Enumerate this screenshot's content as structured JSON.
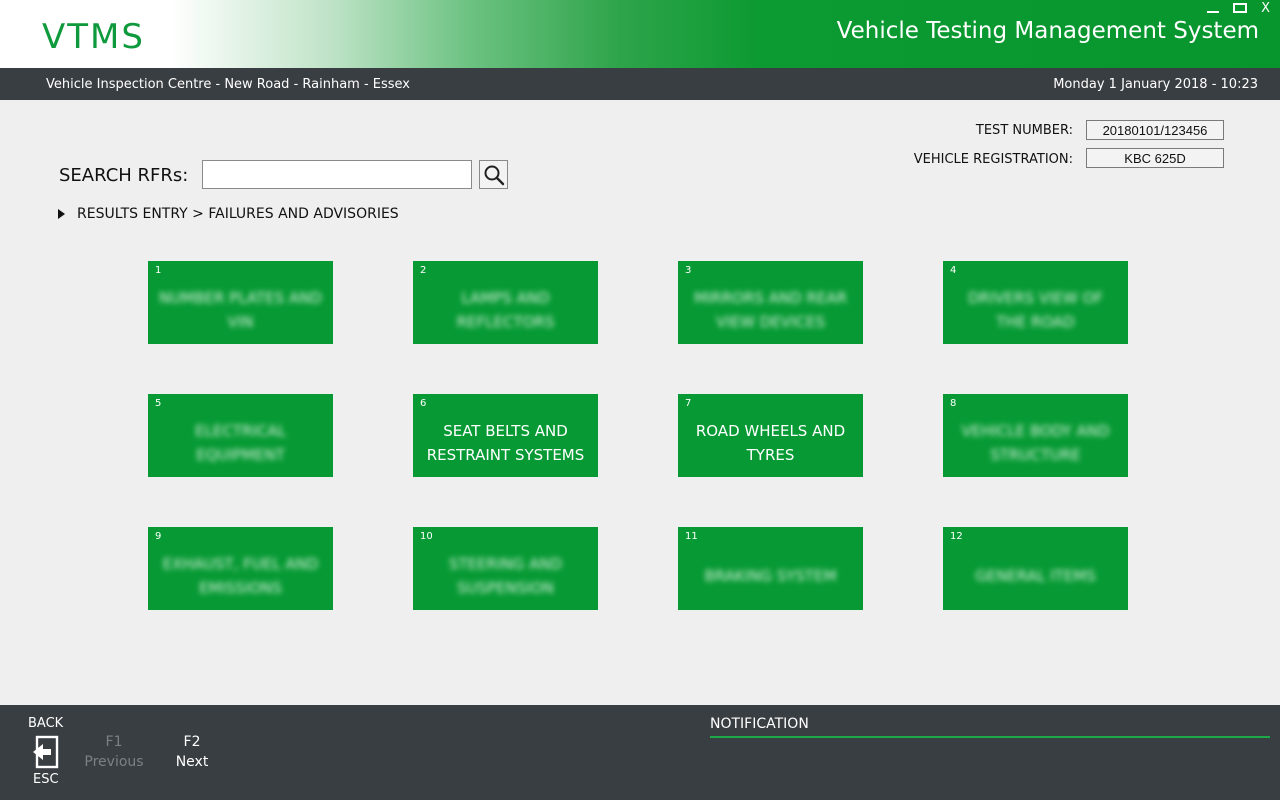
{
  "window": {
    "logo": "VTMS",
    "app_title": "Vehicle Testing Management System",
    "close_glyph": "X"
  },
  "infobar": {
    "location": "Vehicle Inspection Centre - New Road - Rainham - Essex",
    "datetime": "Monday 1 January 2018 - 10:23"
  },
  "test_info": {
    "test_number_label": "TEST NUMBER:",
    "test_number": "20180101/123456",
    "vehicle_reg_label": "VEHICLE REGISTRATION:",
    "vehicle_reg": "KBC 625D"
  },
  "search": {
    "label": "SEARCH RFRs:",
    "value": "",
    "placeholder": ""
  },
  "breadcrumb": {
    "text": "RESULTS ENTRY > FAILURES AND ADVISORIES"
  },
  "categories": [
    {
      "num": "1",
      "label": "NUMBER PLATES AND VIN"
    },
    {
      "num": "2",
      "label": "LAMPS AND REFLECTORS"
    },
    {
      "num": "3",
      "label": "MIRRORS AND REAR VIEW DEVICES"
    },
    {
      "num": "4",
      "label": "DRIVERS VIEW OF THE ROAD"
    },
    {
      "num": "5",
      "label": "ELECTRICAL EQUIPMENT"
    },
    {
      "num": "6",
      "label": "SEAT BELTS AND RESTRAINT SYSTEMS"
    },
    {
      "num": "7",
      "label": "ROAD WHEELS AND TYRES"
    },
    {
      "num": "8",
      "label": "VEHICLE BODY AND STRUCTURE"
    },
    {
      "num": "9",
      "label": "EXHAUST, FUEL AND EMISSIONS"
    },
    {
      "num": "10",
      "label": "STEERING AND SUSPENSION"
    },
    {
      "num": "11",
      "label": "BRAKING SYSTEM"
    },
    {
      "num": "12",
      "label": "GENERAL ITEMS"
    }
  ],
  "footer": {
    "back_label": "BACK",
    "esc_label": "ESC",
    "f1_key": "F1",
    "f1_label": "Previous",
    "f2_key": "F2",
    "f2_label": "Next",
    "notification_label": "NOTIFICATION"
  },
  "colors": {
    "tile_green": "#079a34",
    "bar_dark": "#393e42",
    "accent_green": "#1da84a"
  }
}
